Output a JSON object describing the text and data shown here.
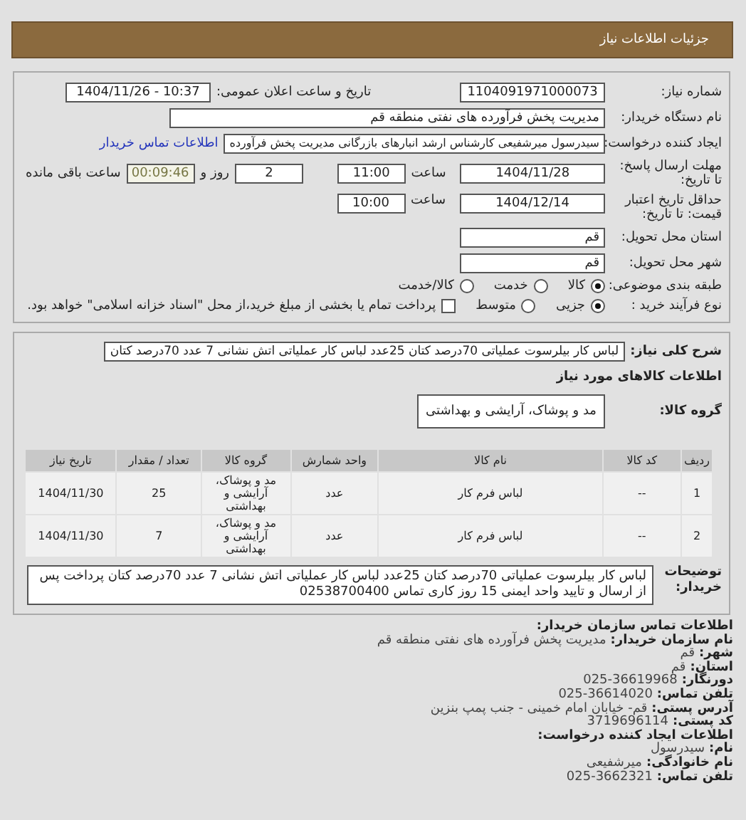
{
  "header": {
    "title": "جزئیات اطلاعات نیاز"
  },
  "need_number": {
    "label": "شماره نیاز:",
    "value": "1104091971000073"
  },
  "announce": {
    "label": "تاریخ و ساعت اعلان عمومی:",
    "value": "1404/11/26 - 10:37"
  },
  "buyer": {
    "label": "نام دستگاه خریدار:",
    "value": "مدیریت پخش فرآورده های نفتی منطقه قم"
  },
  "creator": {
    "label": "ایجاد کننده درخواست:",
    "value": "سیدرسول میرشفیعی کارشناس ارشد انبارهای بازرگانی مدیریت پخش فرآورده",
    "link": "اطلاعات تماس خریدار"
  },
  "deadline": {
    "label": "مهلت ارسال پاسخ: تا تاریخ:",
    "date": "1404/11/28",
    "time_label": "ساعت",
    "time": "11:00",
    "days": "2",
    "days_label": "روز و",
    "remaining": "00:09:46",
    "remaining_label": "ساعت باقی مانده"
  },
  "validity": {
    "label": "حداقل تاریخ اعتبار قیمت: تا تاریخ:",
    "date": "1404/12/14",
    "time_label": "ساعت",
    "time": "10:00"
  },
  "province": {
    "label": "استان محل تحویل:",
    "value": "قم"
  },
  "city": {
    "label": "شهر محل تحویل:",
    "value": "قم"
  },
  "category": {
    "label": "طبقه بندی موضوعی:",
    "options": [
      {
        "label": "کالا",
        "selected": true
      },
      {
        "label": "خدمت",
        "selected": false
      },
      {
        "label": "کالا/خدمت",
        "selected": false
      }
    ]
  },
  "process": {
    "label": "نوع فرآیند خرید :",
    "options": [
      {
        "label": "جزیی",
        "selected": true
      },
      {
        "label": "متوسط",
        "selected": false
      }
    ],
    "payment": {
      "checked": false,
      "text": "پرداخت تمام یا بخشی از مبلغ خرید،از محل \"اسناد خزانه اسلامی\" خواهد بود."
    }
  },
  "description": {
    "label": "شرح کلی نیاز:",
    "value": "لباس کار بیلرسوت عملیاتی 70درصد کتان 25عدد لباس کار عملیاتی اتش نشانی 7 عدد 70درصد کتان"
  },
  "goods_heading": "اطلاعات کالاهای مورد نیاز",
  "goods_group": {
    "label": "گروه کالا:",
    "value": "مد و پوشاک، آرایشی و بهداشتی"
  },
  "table": {
    "columns": [
      "ردیف",
      "کد کالا",
      "نام کالا",
      "واحد شمارش",
      "گروه کالا",
      "تعداد / مقدار",
      "تاریخ نیاز"
    ],
    "rows": [
      [
        "1",
        "--",
        "لباس فرم کار",
        "عدد",
        "مد و پوشاک، آرایشی و بهداشتی",
        "25",
        "1404/11/30"
      ],
      [
        "2",
        "--",
        "لباس فرم کار",
        "عدد",
        "مد و پوشاک، آرایشی و بهداشتی",
        "7",
        "1404/11/30"
      ]
    ]
  },
  "buyer_notes": {
    "label": "توضیحات خریدار:",
    "value": "لباس کار بیلرسوت عملیاتی 70درصد کتان 25عدد لباس کار عملیاتی اتش نشانی 7 عدد 70درصد کتان پرداخت پس از ارسال و تایید واحد ایمنی 15 روز کاری تماس 02538700400"
  },
  "contact": [
    {
      "kind": "heading",
      "label": "اطلاعات تماس سازمان خریدار:"
    },
    {
      "kind": "entry",
      "label": "نام سازمان خریدار:",
      "value": "مدیریت پخش فرآورده های نفتی منطقه قم"
    },
    {
      "kind": "entry",
      "label": "شهر:",
      "value": "قم"
    },
    {
      "kind": "entry",
      "label": "استان:",
      "value": "قم"
    },
    {
      "kind": "entry",
      "label": "دورنگار:",
      "value": "025-36619968"
    },
    {
      "kind": "entry",
      "label": "تلفن تماس:",
      "value": "025-36614020"
    },
    {
      "kind": "entry",
      "label": "آدرس پستی:",
      "value": "قم- خیابان امام خمینی - جنب پمپ بنزین"
    },
    {
      "kind": "entry",
      "label": "کد پستی:",
      "value": "3719696114"
    },
    {
      "kind": "heading",
      "label": "اطلاعات ایجاد کننده درخواست:"
    },
    {
      "kind": "entry",
      "label": "نام:",
      "value": "سیدرسول"
    },
    {
      "kind": "entry",
      "label": "نام خانوادگی:",
      "value": "میرشفیعی"
    },
    {
      "kind": "entry",
      "label": "تلفن تماس:",
      "value": "025-3662321"
    }
  ]
}
